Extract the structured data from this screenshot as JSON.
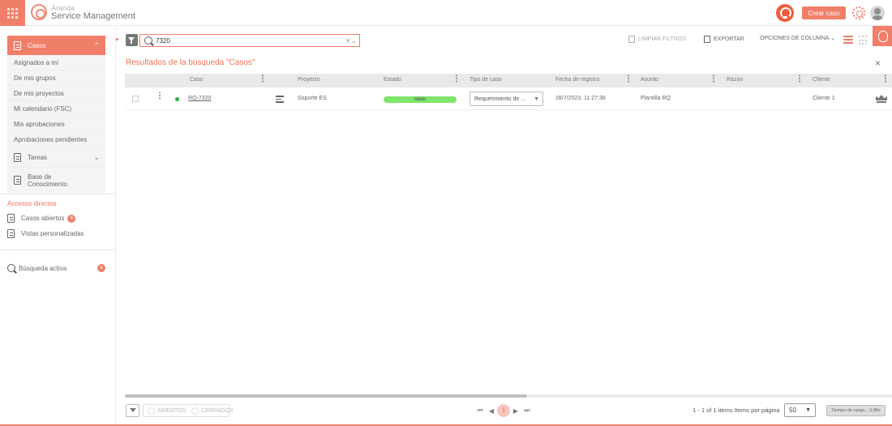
{
  "brand": {
    "top": "Aranda",
    "bottom": "Service Management",
    "accent": "#f07f6a",
    "status_green": "#7ee56b"
  },
  "header": {
    "create_case": "Crear caso",
    "icons": [
      "apps-grid-icon",
      "support-headset-icon",
      "gear-icon",
      "avatar"
    ]
  },
  "sidebar": {
    "section": "Casos",
    "items": [
      "Asignados a mí",
      "De mis grupos",
      "De mis proyectos",
      "Mi calendario (FSC)",
      "Mis aprobaciones",
      "Aprobaciones pendientes"
    ],
    "tasks": "Tareas",
    "knowledge_base": "Base de Conocimiento",
    "shortcuts_title": "Accesos directos",
    "shortcuts": [
      {
        "label": "Casos abiertos",
        "badge": "6"
      },
      {
        "label": "Vistas personalizadas"
      }
    ],
    "active_search": "Búsqueda activa",
    "close_symbol": "×"
  },
  "toolbar": {
    "search_value": "7320",
    "clear_filters": "LIMPIAR FILTROS",
    "export": "EXPORTAR",
    "column_options": "OPCIONES DE COLUMNA",
    "close_symbol": "×"
  },
  "results": {
    "title": "Resultados de la búsqueda \"Casos\"",
    "columns": [
      "Caso",
      "Proyecto",
      "Estado",
      "Tipo de caso",
      "Fecha de registro",
      "Asunto",
      "Razón",
      "Cliente"
    ],
    "rows": [
      {
        "case": "RQ-7320",
        "project": "Soporte ES",
        "status": "Inicio",
        "type": "Requerimiento de ...",
        "date": "28/7/2023, 11:27:38",
        "subject": "Plantilla RQ",
        "reason": "",
        "client": "Cliente 1"
      }
    ]
  },
  "footer": {
    "open": "ABIERTOS",
    "closed": "CERRADOS",
    "first": "⏮",
    "prev": "◀",
    "current_page": "1",
    "next": "▶",
    "last": "⏭",
    "page_info": "1 - 1 of 1 items Items por página",
    "page_size": "50",
    "load_time": "Tiempo de carga... 0.88s"
  }
}
